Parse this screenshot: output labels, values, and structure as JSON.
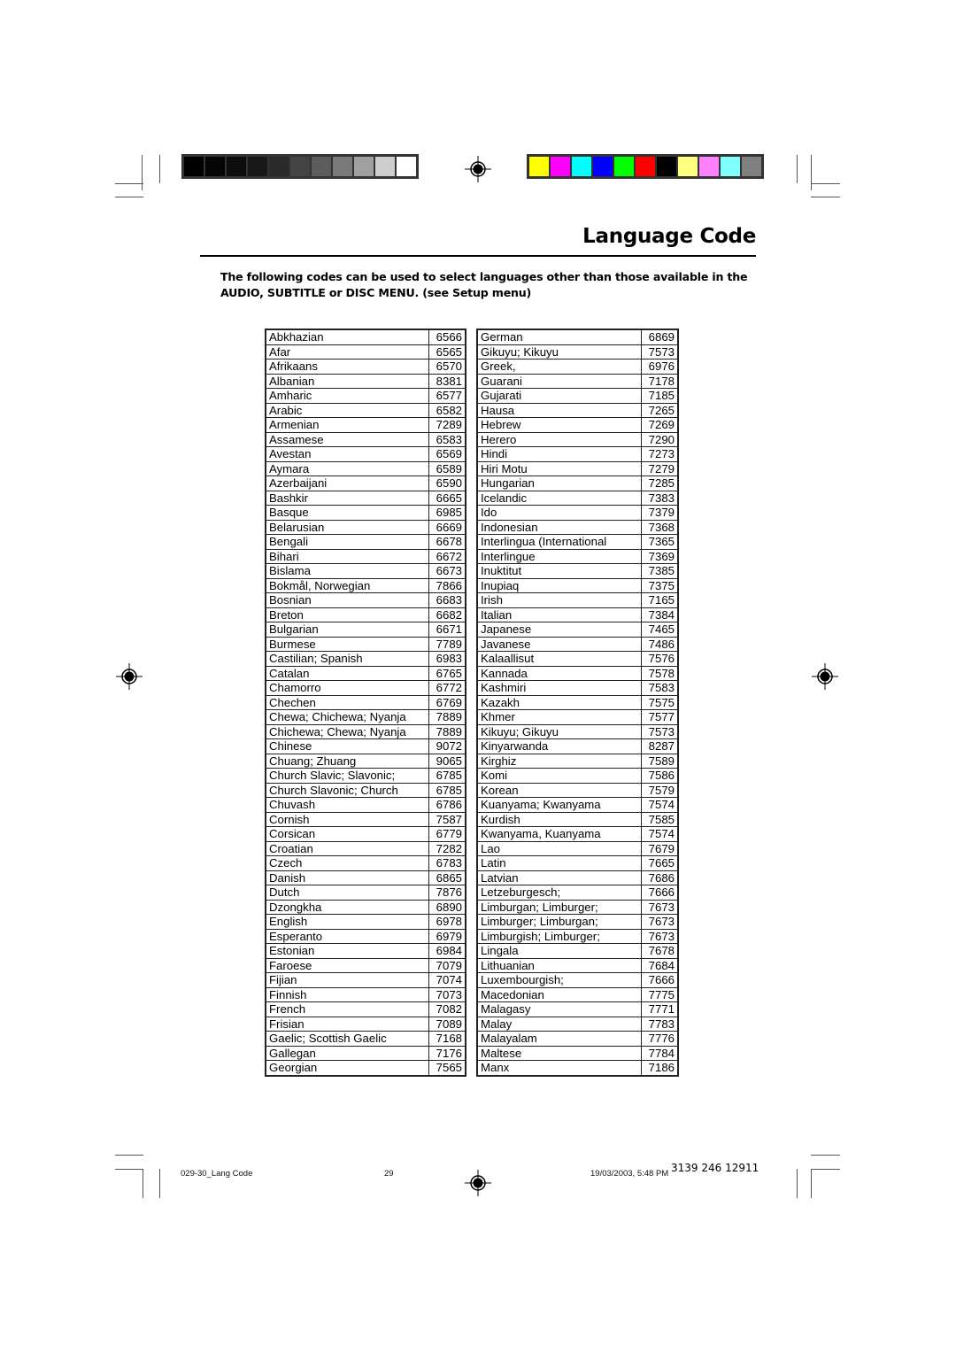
{
  "page": {
    "title": "Language Code",
    "intro_line1": "The following codes can be used to select languages other than those available in the",
    "intro_line2": "AUDIO, SUBTITLE or DISC MENU. (see Setup menu)"
  },
  "calibration": {
    "grayscale": [
      "#000000",
      "#050505",
      "#0d0d0d",
      "#181818",
      "#2a2a2a",
      "#444444",
      "#5c5c5c",
      "#7a7a7a",
      "#a0a0a0",
      "#cecece",
      "#ffffff"
    ],
    "colors": [
      "#ffff00",
      "#ff00ff",
      "#00ffff",
      "#0000ff",
      "#00ff00",
      "#ff0000",
      "#000000",
      "#ffff80",
      "#ff80ff",
      "#80ffff",
      "#808080"
    ]
  },
  "tables": {
    "left": [
      {
        "language": "Abkhazian",
        "code": "6566"
      },
      {
        "language": "Afar",
        "code": "6565"
      },
      {
        "language": "Afrikaans",
        "code": "6570"
      },
      {
        "language": "Albanian",
        "code": "8381"
      },
      {
        "language": "Amharic",
        "code": "6577"
      },
      {
        "language": "Arabic",
        "code": "6582"
      },
      {
        "language": "Armenian",
        "code": "7289"
      },
      {
        "language": "Assamese",
        "code": "6583"
      },
      {
        "language": "Avestan",
        "code": "6569"
      },
      {
        "language": "Aymara",
        "code": "6589"
      },
      {
        "language": "Azerbaijani",
        "code": "6590"
      },
      {
        "language": "Bashkir",
        "code": "6665"
      },
      {
        "language": "Basque",
        "code": "6985"
      },
      {
        "language": "Belarusian",
        "code": "6669"
      },
      {
        "language": "Bengali",
        "code": "6678"
      },
      {
        "language": "Bihari",
        "code": "6672"
      },
      {
        "language": "Bislama",
        "code": "6673"
      },
      {
        "language": "Bokmål, Norwegian",
        "code": "7866"
      },
      {
        "language": "Bosnian",
        "code": "6683"
      },
      {
        "language": "Breton",
        "code": "6682"
      },
      {
        "language": "Bulgarian",
        "code": "6671"
      },
      {
        "language": "Burmese",
        "code": "7789"
      },
      {
        "language": "Castilian; Spanish",
        "code": "6983"
      },
      {
        "language": "Catalan",
        "code": "6765"
      },
      {
        "language": "Chamorro",
        "code": "6772"
      },
      {
        "language": "Chechen",
        "code": "6769"
      },
      {
        "language": "Chewa; Chichewa; Nyanja",
        "code": "7889"
      },
      {
        "language": "Chichewa; Chewa; Nyanja",
        "code": "7889"
      },
      {
        "language": "Chinese",
        "code": "9072"
      },
      {
        "language": "Chuang; Zhuang",
        "code": "9065"
      },
      {
        "language": "Church Slavic; Slavonic;",
        "code": "6785"
      },
      {
        "language": "Church Slavonic; Church",
        "code": "6785"
      },
      {
        "language": "Chuvash",
        "code": "6786"
      },
      {
        "language": "Cornish",
        "code": "7587"
      },
      {
        "language": "Corsican",
        "code": "6779"
      },
      {
        "language": "Croatian",
        "code": "7282"
      },
      {
        "language": "Czech",
        "code": "6783"
      },
      {
        "language": "Danish",
        "code": "6865"
      },
      {
        "language": "Dutch",
        "code": "7876"
      },
      {
        "language": "Dzongkha",
        "code": "6890"
      },
      {
        "language": "English",
        "code": "6978"
      },
      {
        "language": "Esperanto",
        "code": "6979"
      },
      {
        "language": "Estonian",
        "code": "6984"
      },
      {
        "language": "Faroese",
        "code": "7079"
      },
      {
        "language": "Fijian",
        "code": "7074"
      },
      {
        "language": "Finnish",
        "code": "7073"
      },
      {
        "language": "French",
        "code": "7082"
      },
      {
        "language": "Frisian",
        "code": "7089"
      },
      {
        "language": "Gaelic; Scottish Gaelic",
        "code": "7168"
      },
      {
        "language": "Gallegan",
        "code": "7176"
      },
      {
        "language": "Georgian",
        "code": "7565"
      }
    ],
    "right": [
      {
        "language": "German",
        "code": "6869"
      },
      {
        "language": "Gikuyu; Kikuyu",
        "code": "7573"
      },
      {
        "language": "Greek,",
        "code": "6976"
      },
      {
        "language": "Guarani",
        "code": "7178"
      },
      {
        "language": "Gujarati",
        "code": "7185"
      },
      {
        "language": "Hausa",
        "code": "7265"
      },
      {
        "language": "Hebrew",
        "code": "7269"
      },
      {
        "language": "Herero",
        "code": "7290"
      },
      {
        "language": "Hindi",
        "code": "7273"
      },
      {
        "language": "Hiri Motu",
        "code": "7279"
      },
      {
        "language": "Hungarian",
        "code": "7285"
      },
      {
        "language": "Icelandic",
        "code": "7383"
      },
      {
        "language": "Ido",
        "code": "7379"
      },
      {
        "language": "Indonesian",
        "code": "7368"
      },
      {
        "language": "Interlingua (International",
        "code": "7365"
      },
      {
        "language": "Interlingue",
        "code": "7369"
      },
      {
        "language": "Inuktitut",
        "code": "7385"
      },
      {
        "language": "Inupiaq",
        "code": "7375"
      },
      {
        "language": "Irish",
        "code": "7165"
      },
      {
        "language": "Italian",
        "code": "7384"
      },
      {
        "language": "Japanese",
        "code": "7465"
      },
      {
        "language": "Javanese",
        "code": "7486"
      },
      {
        "language": "Kalaallisut",
        "code": "7576"
      },
      {
        "language": "Kannada",
        "code": "7578"
      },
      {
        "language": "Kashmiri",
        "code": "7583"
      },
      {
        "language": "Kazakh",
        "code": "7575"
      },
      {
        "language": "Khmer",
        "code": "7577"
      },
      {
        "language": "Kikuyu; Gikuyu",
        "code": "7573"
      },
      {
        "language": "Kinyarwanda",
        "code": "8287"
      },
      {
        "language": "Kirghiz",
        "code": "7589"
      },
      {
        "language": "Komi",
        "code": "7586"
      },
      {
        "language": "Korean",
        "code": "7579"
      },
      {
        "language": "Kuanyama; Kwanyama",
        "code": "7574"
      },
      {
        "language": "Kurdish",
        "code": "7585"
      },
      {
        "language": "Kwanyama, Kuanyama",
        "code": "7574"
      },
      {
        "language": "Lao",
        "code": "7679"
      },
      {
        "language": "Latin",
        "code": "7665"
      },
      {
        "language": "Latvian",
        "code": "7686"
      },
      {
        "language": "Letzeburgesch;",
        "code": "7666"
      },
      {
        "language": "Limburgan; Limburger;",
        "code": "7673"
      },
      {
        "language": "Limburger; Limburgan;",
        "code": "7673"
      },
      {
        "language": "Limburgish; Limburger;",
        "code": "7673"
      },
      {
        "language": "Lingala",
        "code": "7678"
      },
      {
        "language": "Lithuanian",
        "code": "7684"
      },
      {
        "language": "Luxembourgish;",
        "code": "7666"
      },
      {
        "language": "Macedonian",
        "code": "7775"
      },
      {
        "language": "Malagasy",
        "code": "7771"
      },
      {
        "language": "Malay",
        "code": "7783"
      },
      {
        "language": "Malayalam",
        "code": "7776"
      },
      {
        "language": "Maltese",
        "code": "7784"
      },
      {
        "language": "Manx",
        "code": "7186"
      }
    ]
  },
  "footer": {
    "file_name": "029-30_Lang Code",
    "page_number": "29",
    "timestamp": "19/03/2003, 5:48 PM",
    "doc_code": "3139 246 12911"
  }
}
